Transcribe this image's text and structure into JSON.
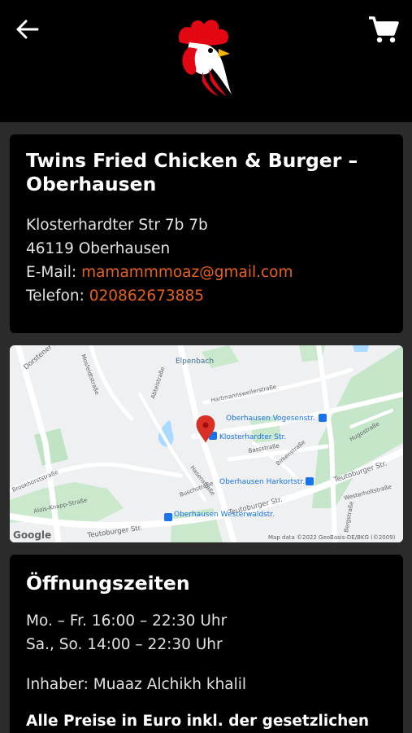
{
  "header": {
    "back_icon": "arrow-left-icon",
    "cart_icon": "shopping-cart-icon",
    "logo_icon": "rooster-logo"
  },
  "restaurant": {
    "name": "Twins Fried Chicken & Burger – Oberhausen",
    "street": "Klosterhardter Str 7b 7b",
    "city": "46119 Oberhausen",
    "email_label": "E-Mail:",
    "email": "mamammmoaz@gmail.com",
    "phone_label": "Telefon:",
    "phone": "020862673885"
  },
  "map": {
    "place_label": "Elpenbach",
    "stops": [
      "Klosterhardter Str.",
      "Oberhausen Vogesenstr.",
      "Oberhausen Harkortstr.",
      "Oberhausen Westerwaldstr."
    ],
    "streets": [
      "Dorstener Str.",
      "Mosfeldtstraße",
      "Hartmannsweilerstraße",
      "Abteistraße",
      "Bassstraße",
      "Birkenstraße",
      "Hugostraße",
      "Teutoburger Str.",
      "Westerholtstraße",
      "Bergstraße",
      "Buschstraße",
      "Hasenstraße",
      "Brookhorststraße",
      "Alois-Knapp-Straße"
    ],
    "google_label": "Google",
    "attribution": "Map data ©2022 GeoBasis-DE/BKG (©2009)"
  },
  "hours": {
    "title": "Öffnungszeiten",
    "weekdays": "Mo. – Fr. 16:00 – 22:30 Uhr",
    "weekend": "Sa., So. 14:00 – 22:30 Uhr",
    "owner": "Inhaber: Muaaz Alchikh khalil",
    "prices_note": "Alle Preise in Euro inkl. der gesetzlichen"
  },
  "colors": {
    "accent": "#e8601c",
    "logo_red": "#e30613",
    "pin_red": "#d93025",
    "transit_blue": "#1a73e8"
  }
}
